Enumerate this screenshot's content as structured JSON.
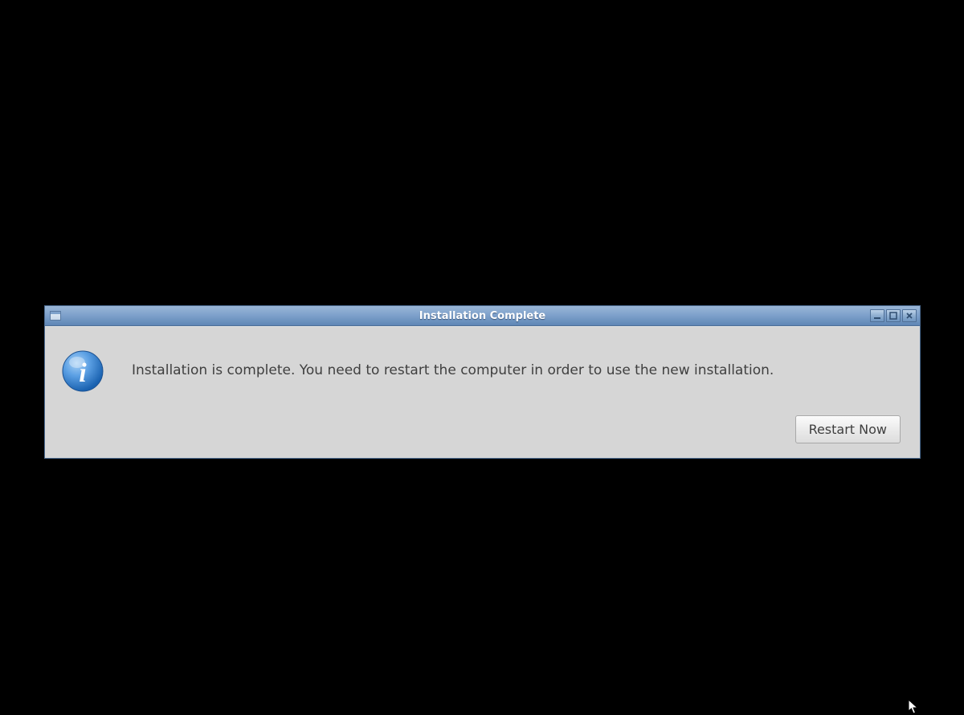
{
  "dialog": {
    "title": "Installation Complete",
    "message": "Installation is complete. You need to restart the computer in order to use the new installation.",
    "restart_label": "Restart Now"
  }
}
